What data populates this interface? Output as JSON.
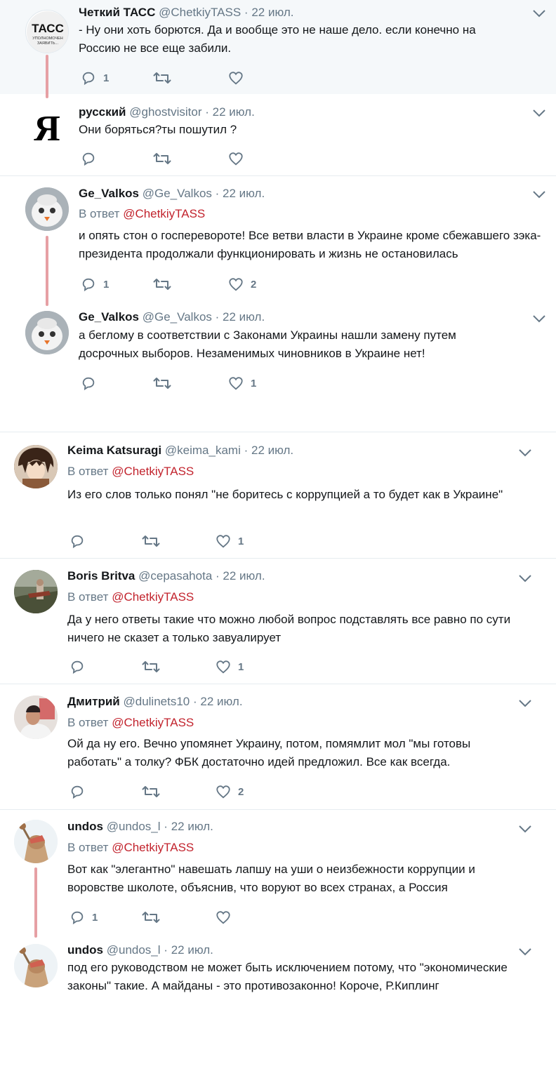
{
  "tweets": [
    {
      "name": "Четкий ТАСС",
      "handle": "@ChetkiyTASS",
      "date": "22 июл.",
      "reply_prefix": "",
      "reply_to": "",
      "text": "- Ну они хоть борются. Да и вообще это не наше дело. если конечно на Россию не все еще забили.",
      "replies": "1",
      "retweets": "",
      "likes": "",
      "avatar": "tass-logo",
      "avatar_text": "ТАСС",
      "avatar_sub": "УПОЛНОМОЧЕН ЗАЯВИТЬ..."
    },
    {
      "name": "русский",
      "handle": "@ghostvisitor",
      "date": "22 июл.",
      "reply_prefix": "",
      "reply_to": "",
      "text": "Они боряться?ты пошутил ?",
      "replies": "",
      "retweets": "",
      "likes": "",
      "avatar": "ya-letter",
      "avatar_text": "Я"
    },
    {
      "name": "Ge_Valkos",
      "handle": "@Ge_Valkos",
      "date": "22 июл.",
      "reply_prefix": "В ответ",
      "reply_to": "@ChetkiyTASS",
      "text": "и опять стон о госперевороте! Все ветви власти в Украине кроме сбежавшего зэка-президента продолжали функционировать и жизнь не остановилась",
      "replies": "1",
      "retweets": "",
      "likes": "2",
      "avatar": "cat-photo"
    },
    {
      "name": "Ge_Valkos",
      "handle": "@Ge_Valkos",
      "date": "22 июл.",
      "reply_prefix": "",
      "reply_to": "",
      "text": "а беглому в соответствии с Законами Украины нашли замену путем досрочных выборов. Незаменимых чиновников в Украине нет!",
      "replies": "",
      "retweets": "",
      "likes": "1",
      "avatar": "cat-photo"
    },
    {
      "name": "Keima Katsuragi",
      "handle": "@keima_kami",
      "date": "22 июл.",
      "reply_prefix": "В ответ",
      "reply_to": "@ChetkiyTASS",
      "text": "Из его слов только понял \"не боритесь с коррупцией а то будет как в Украине\"",
      "replies": "",
      "retweets": "",
      "likes": "1",
      "avatar": "anime-photo"
    },
    {
      "name": "Boris Britva",
      "handle": "@cepasahota",
      "date": "22 июл.",
      "reply_prefix": "В ответ",
      "reply_to": "@ChetkiyTASS",
      "text": "Да у него ответы такие что можно любой вопрос подставлять все равно по сути ничего не сказет а только завуалирует",
      "replies": "",
      "retweets": "",
      "likes": "1",
      "avatar": "painting-photo"
    },
    {
      "name": "Дмитрий",
      "handle": "@dulinets10",
      "date": "22 июл.",
      "reply_prefix": "В ответ",
      "reply_to": "@ChetkiyTASS",
      "text": "Ой да ну его. Вечно упомянет Украину, потом, помямлит мол \"мы готовы работать\" а толку? ФБК достаточно идей предложил. Все как всегда.",
      "replies": "",
      "retweets": "",
      "likes": "2",
      "avatar": "person-photo"
    },
    {
      "name": "undos",
      "handle": "@undos_l",
      "date": "22 июл.",
      "reply_prefix": "В ответ",
      "reply_to": "@ChetkiyTASS",
      "text": "Вот как \"элегантно\" навешать лапшу на уши о неизбежности коррупции и воровстве школоте, объяснив, что воруют во всех странах,  а Россия",
      "replies": "1",
      "retweets": "",
      "likes": "",
      "avatar": "statue-photo"
    },
    {
      "name": "undos",
      "handle": "@undos_l",
      "date": "22 июл.",
      "reply_prefix": "",
      "reply_to": "",
      "text": "под его руководством не может быть исключением потому, что \"экономические законы\" такие. А майданы - это противозаконно! Короче, Р.Киплинг",
      "replies": "",
      "retweets": "",
      "likes": "",
      "avatar": "statue-photo"
    }
  ],
  "colors": {
    "mention": "#c2232d",
    "muted": "#657786",
    "text": "#14171a",
    "thread_line": "#e6a0a4",
    "highlight_bg": "#f5f8fa"
  },
  "icons": [
    "reply-icon",
    "retweet-icon",
    "like-icon",
    "chevron-down-icon"
  ]
}
